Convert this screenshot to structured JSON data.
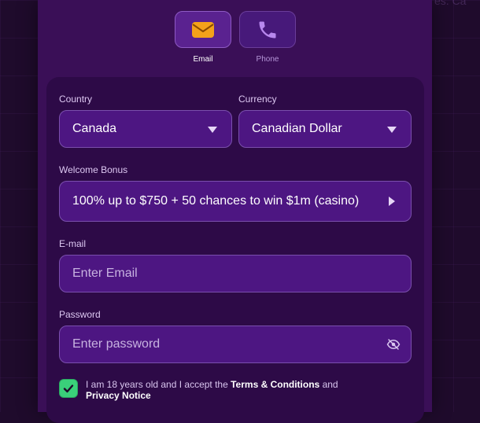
{
  "background_text": "es. Ca",
  "methods": {
    "email_label": "Email",
    "phone_label": "Phone",
    "selected": "email"
  },
  "form": {
    "country": {
      "label": "Country",
      "value": "Canada"
    },
    "currency": {
      "label": "Currency",
      "value": "Canadian Dollar"
    },
    "bonus": {
      "label": "Welcome Bonus",
      "value": "100% up to $750 + 50 chances to win $1m (casino)"
    },
    "email": {
      "label": "E-mail",
      "placeholder": "Enter Email"
    },
    "password": {
      "label": "Password",
      "placeholder": "Enter password"
    },
    "terms": {
      "checked": true,
      "prefix": "I am 18 years old and I accept the ",
      "terms_link": "Terms & Conditions",
      "and": " and ",
      "privacy_link": "Privacy Notice"
    }
  },
  "colors": {
    "modal_bg": "#3a0f57",
    "card_bg": "#2d0a47",
    "field_bg": "#4d1682",
    "accent_check": "#3ad07a",
    "email_icon": "#f4a21a",
    "phone_icon": "#b888ee"
  },
  "icons": {
    "email": "envelope-icon",
    "phone": "phone-icon",
    "password_toggle": "eye-off-icon",
    "dropdown": "chevron-down-icon",
    "bonus": "chevron-right-icon",
    "checkbox": "checkmark-icon"
  }
}
